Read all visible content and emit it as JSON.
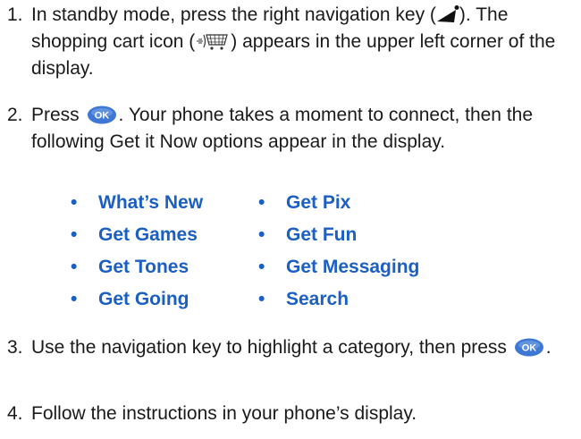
{
  "steps": [
    {
      "number": "1.",
      "text_a": "In standby mode, press the right navigation key (",
      "text_b": "). The shopping cart icon (",
      "text_c": ") appears in the upper left corner of the display."
    },
    {
      "number": "2.",
      "text_a": "Press",
      "text_b": ". Your phone takes a moment to connect, then the following Get it Now options appear in the display."
    },
    {
      "number": "3.",
      "text_a": "Use the navigation key to highlight a category, then press",
      "text_b": "."
    },
    {
      "number": "4.",
      "text_a": "Follow the instructions in your phone’s display."
    }
  ],
  "options": [
    {
      "label": "What’s New"
    },
    {
      "label": "Get Games"
    },
    {
      "label": "Get Tones"
    },
    {
      "label": "Get Going"
    },
    {
      "label": "Get Pix"
    },
    {
      "label": "Get Fun"
    },
    {
      "label": "Get Messaging"
    },
    {
      "label": "Search"
    }
  ],
  "bullet_symbol": "•",
  "ok_key_label": "OK",
  "icons": {
    "nav_key": "right-navigation-key-icon",
    "cart": "shopping-cart-icon",
    "ok": "ok-key-icon"
  },
  "colors": {
    "option_text": "#1c5fc2",
    "body_text": "#1a1a1a",
    "ok_key": "#3f77d4"
  }
}
